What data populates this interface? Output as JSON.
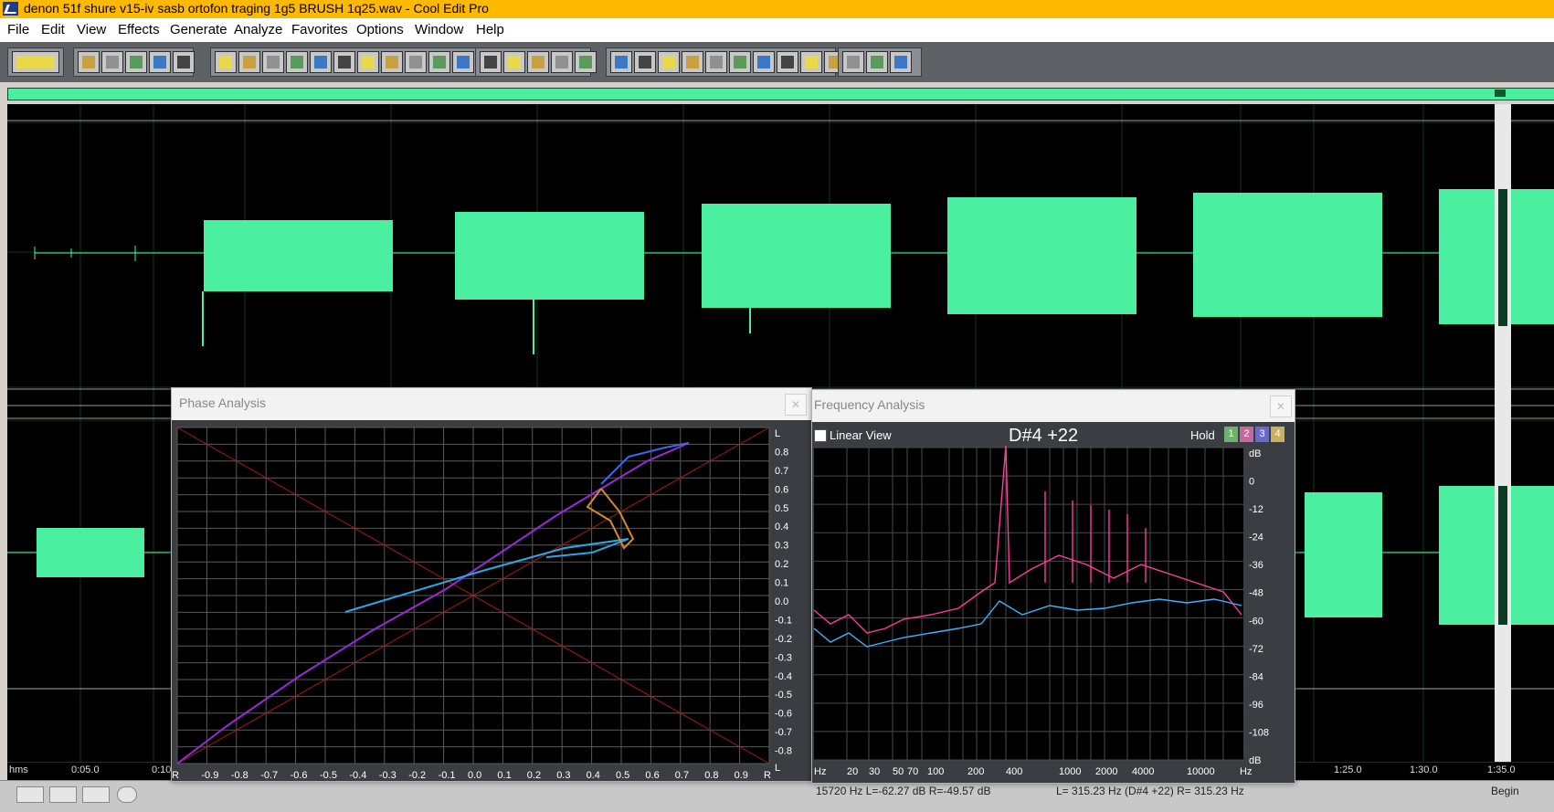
{
  "window": {
    "title": "denon 51f shure v15-iv sasb ortofon traging 1g5 BRUSH 1q25.wav - Cool Edit Pro"
  },
  "menu": [
    "File",
    "Edit",
    "View",
    "Effects",
    "Generate",
    "Analyze",
    "Favorites",
    "Options",
    "Window",
    "Help"
  ],
  "toolbar_icons": [
    "transport-icon",
    "new-file-icon",
    "open-folder-icon",
    "save-icon",
    "save-all-icon",
    "close-file-icon",
    "undo-icon",
    "redo-icon",
    "repeat-icon",
    "copy-icon",
    "copy-new-icon",
    "cut-icon",
    "paste-icon",
    "paste-new-icon",
    "mix-paste-icon",
    "trim-icon",
    "trim-to-selection-icon",
    "spectral-view-icon",
    "marker-icon",
    "zoom-in-icon",
    "zoom-out-icon",
    "zoom-full-icon",
    "multitrack-icon",
    "cue-list-icon",
    "playlist-icon",
    "play-icon",
    "find-icon",
    "time-format-icon",
    "batch-icon",
    "meter-icon",
    "frequency-icon",
    "scripts-icon",
    "settings-icon",
    "help-icon"
  ],
  "timeline": {
    "labels": [
      "hms",
      "0:05.0",
      "0:10",
      "1:25.0",
      "1:30.0",
      "1:35.0"
    ]
  },
  "status": {
    "left_readout": "15720 Hz  L=-62.27 dB  R=-49.57 dB",
    "right_readout": "L= 315.23 Hz (D#4 +22)  R= 315.23 Hz",
    "begin_label": "Begin"
  },
  "phase": {
    "title": "Phase Analysis",
    "close": "✕",
    "y_labels": [
      "L",
      "0.8",
      "0.7",
      "0.6",
      "0.5",
      "0.4",
      "0.3",
      "0.2",
      "0.1",
      "0.0",
      "-0.1",
      "-0.2",
      "-0.3",
      "-0.4",
      "-0.5",
      "-0.6",
      "-0.7",
      "-0.8",
      "L"
    ],
    "x_labels": [
      "R",
      "-0.9",
      "-0.8",
      "-0.7",
      "-0.6",
      "-0.5",
      "-0.4",
      "-0.3",
      "-0.2",
      "-0.1",
      "0.0",
      "0.1",
      "0.2",
      "0.3",
      "0.4",
      "0.5",
      "0.6",
      "0.7",
      "0.8",
      "0.9",
      "R"
    ]
  },
  "frequency": {
    "title": "Frequency Analysis",
    "close": "✕",
    "linear_view_label": "Linear View",
    "linear_view_checked": false,
    "note": "D#4 +22",
    "hold_label": "Hold",
    "hold_buttons": [
      "1",
      "2",
      "3",
      "4"
    ],
    "hold_colors": [
      "#6fb06f",
      "#c46a9a",
      "#6a6ac8",
      "#c8b060"
    ],
    "db_labels": [
      "dB",
      "0",
      "-12",
      "-24",
      "-36",
      "-48",
      "-60",
      "-72",
      "-84",
      "-96",
      "-108",
      "dB"
    ],
    "hz_labels": [
      "Hz",
      "20",
      "30",
      "50",
      "70",
      "100",
      "200",
      "400",
      "1000",
      "2000",
      "4000",
      "10000",
      "Hz"
    ]
  },
  "colors": {
    "titlebar": "#ffb900",
    "waveform": "#4af0a0",
    "waveform_selected": "#0c3a22",
    "spectrum_left": "#ff3c9c",
    "spectrum_right": "#3cb4ff"
  }
}
